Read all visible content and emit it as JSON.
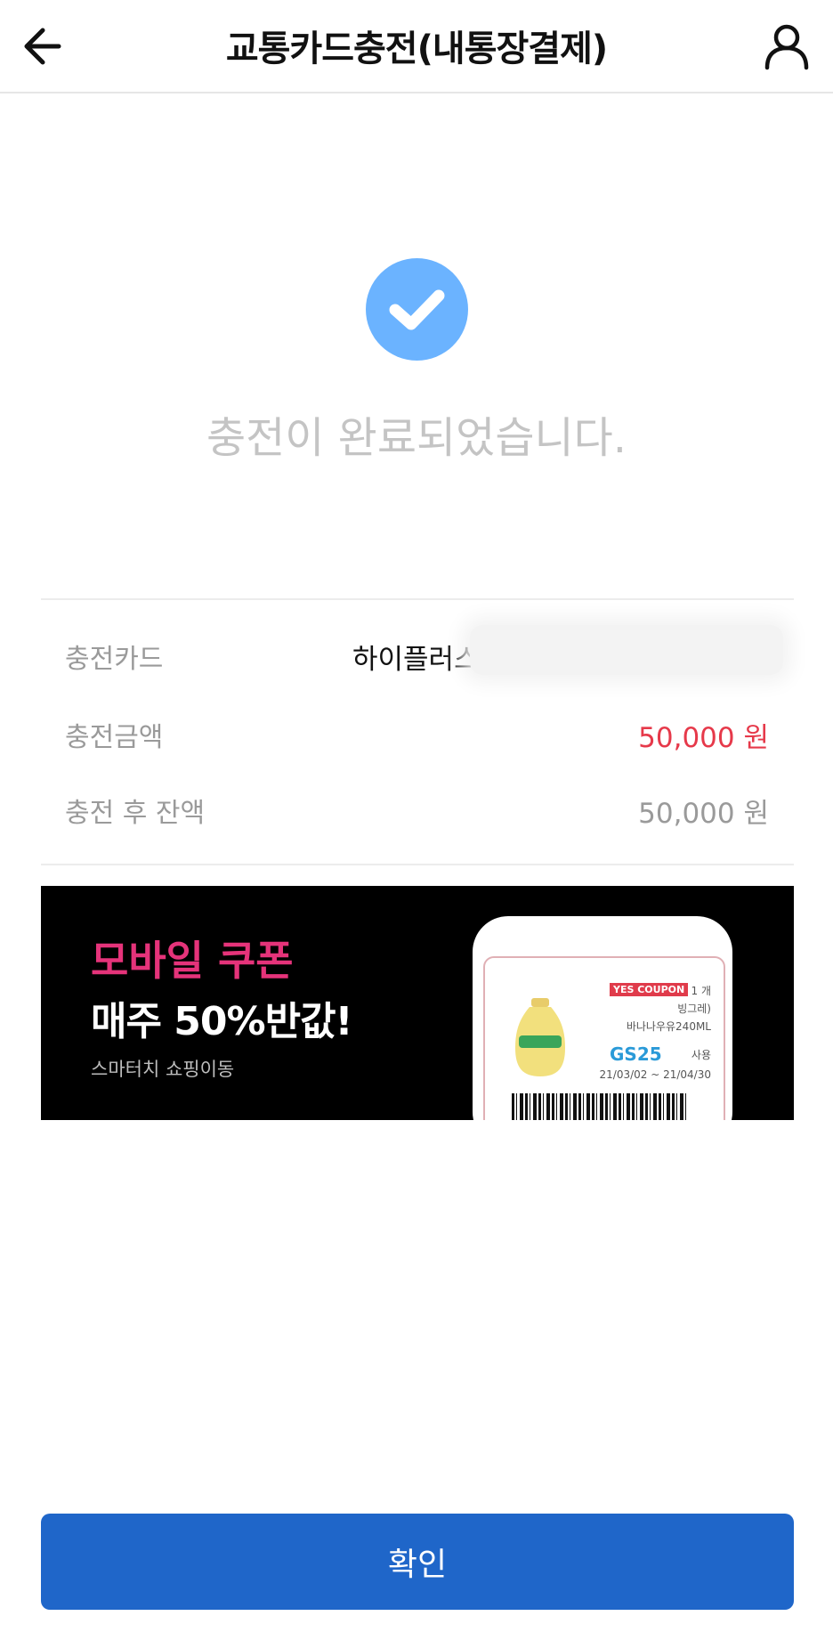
{
  "header": {
    "title": "교통카드충전(내통장결제)",
    "back_icon": "arrow-left-icon",
    "user_icon": "user-icon"
  },
  "status": {
    "icon": "check-circle-icon",
    "message": "충전이 완료되었습니다."
  },
  "details": {
    "card_label": "충전카드",
    "card_value": "하이플러스",
    "amount_label": "충전금액",
    "amount_value": "50,000 원",
    "balance_label": "충전 후 잔액",
    "balance_value": "50,000 원"
  },
  "banner": {
    "headline_pink": "모바일 쿠폰",
    "headline_white": "매주 50%반값!",
    "subtext": "스마터치 쇼핑이동",
    "coupon": {
      "label": "YES COUPON",
      "qty": "1 개",
      "name1": "빙그레)",
      "name2": "바나나우유240ML",
      "brand": "GS25",
      "use": "사용",
      "date": "21/03/02 ~ 21/04/30"
    }
  },
  "confirm_button": "확인",
  "colors": {
    "primary": "#1f66c9",
    "check": "#6bb3ff",
    "amount": "#e6394a",
    "banner_pink": "#e5337a"
  }
}
